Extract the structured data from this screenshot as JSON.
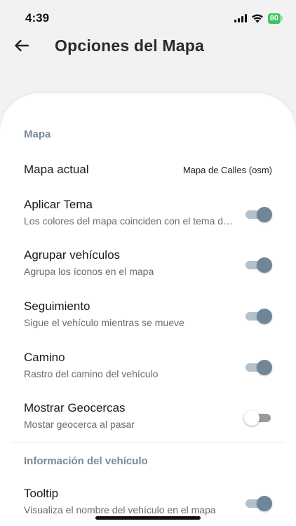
{
  "status_bar": {
    "time": "4:39",
    "battery": "80",
    "battery_color": "#3cc35f"
  },
  "header": {
    "title": "Opciones del Mapa",
    "back_icon": "arrow-left-icon"
  },
  "sections": {
    "map": {
      "title": "Mapa",
      "current_map": {
        "label": "Mapa actual",
        "value": "Mapa de Calles (osm)"
      },
      "theme": {
        "label": "Aplicar Tema",
        "subtitle": "Los colores del mapa coinciden con el tema de la aplicación",
        "enabled": true
      },
      "group": {
        "label": "Agrupar vehículos",
        "subtitle": "Agrupa los íconos en el mapa",
        "enabled": true
      },
      "follow": {
        "label": "Seguimiento",
        "subtitle": "Sigue el vehículo mientras se mueve",
        "enabled": true
      },
      "path": {
        "label": "Camino",
        "subtitle": "Rastro del camino del vehículo",
        "enabled": true
      },
      "geofences": {
        "label": "Mostrar Geocercas",
        "subtitle": "Mostar geocerca al pasar",
        "enabled": false
      }
    },
    "vehicle_info": {
      "title": "Información del vehículo",
      "tooltip": {
        "label": "Tooltip",
        "subtitle": "Visualiza el nombre del vehículo en el mapa",
        "enabled": true
      }
    }
  },
  "colors": {
    "toggle_on_knob": "#6f8698",
    "toggle_on_track": "#b4c0ca",
    "section_header": "#7a8a99"
  }
}
